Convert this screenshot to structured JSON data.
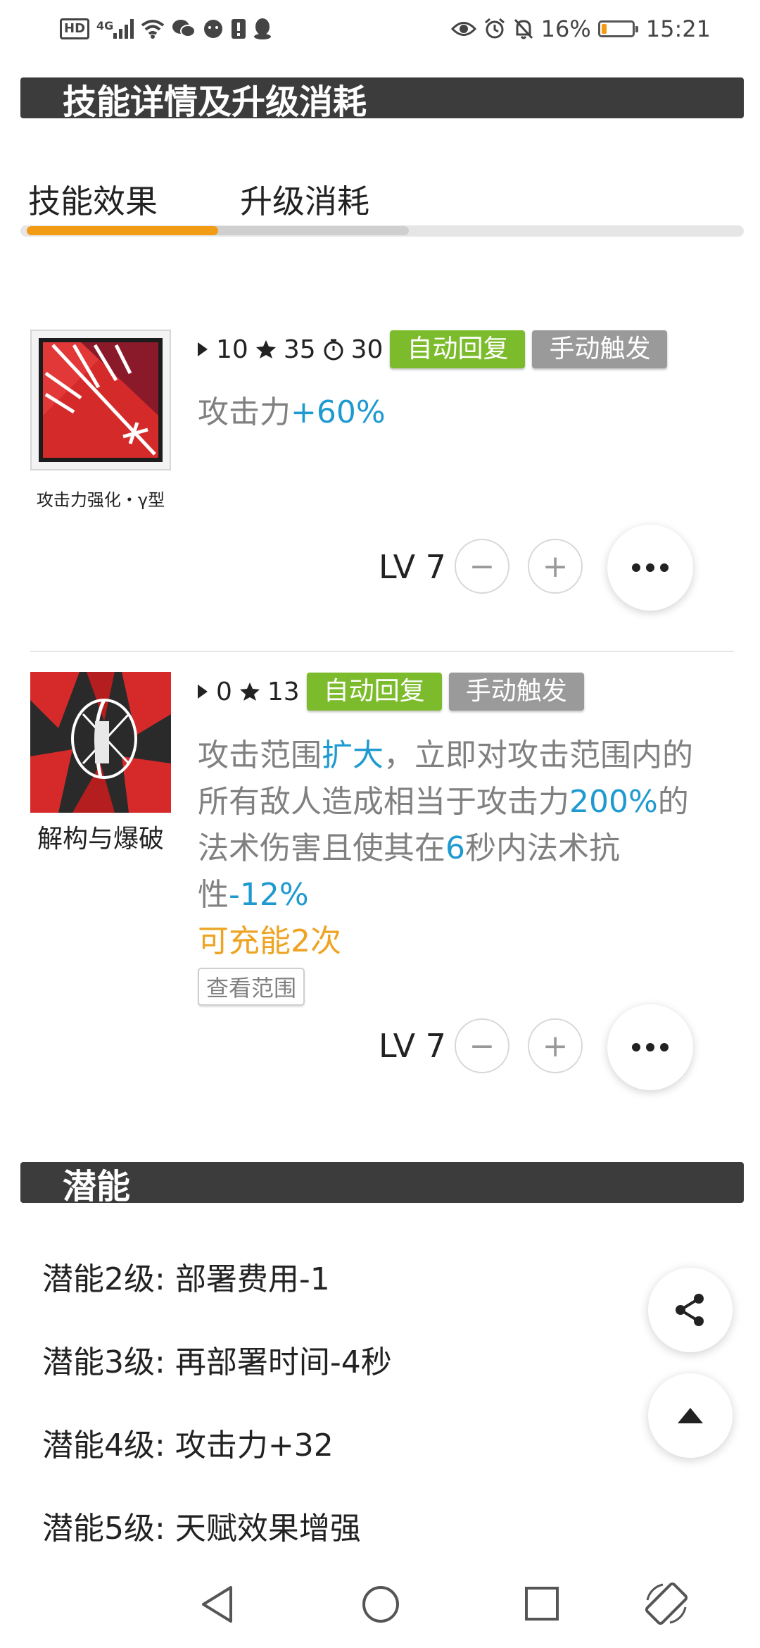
{
  "status_bar": {
    "network": "4G",
    "battery_percent": "16%",
    "battery_level": 0.16,
    "time": "15:21"
  },
  "section1": {
    "title": "技能详情及升级消耗"
  },
  "tabs": [
    {
      "label": "技能效果",
      "active": true
    },
    {
      "label": "升级消耗",
      "active": false
    }
  ],
  "skills": [
    {
      "name": "攻击力强化・γ型",
      "sp_initial": "10",
      "sp_cost": "35",
      "duration": "30",
      "badges": [
        "自动回复",
        "手动触发"
      ],
      "desc_parts": [
        "攻击力",
        "+60%"
      ],
      "level": "LV 7",
      "minus": "−",
      "plus": "+"
    },
    {
      "name": "解构与爆破",
      "sp_initial": "0",
      "sp_cost": "13",
      "badges": [
        "自动回复",
        "手动触发"
      ],
      "desc_line1": [
        "攻击范围",
        "扩大",
        "，立即对攻击范围内的"
      ],
      "desc_line2": [
        "所有敌人造成相当于攻击力",
        "200%",
        "的"
      ],
      "desc_line3": [
        "法术伤害且使其在",
        "6",
        "秒内法术抗"
      ],
      "desc_line4": [
        "性",
        "-12%"
      ],
      "charge_text": "可充能2次",
      "view_range": "查看范围",
      "level": "LV 7",
      "minus": "−",
      "plus": "+"
    }
  ],
  "section2": {
    "title": "潜能"
  },
  "potentials": [
    {
      "label": "潜能2级:",
      "value": "部署费用-1"
    },
    {
      "label": "潜能3级:",
      "value": "再部署时间-4秒"
    },
    {
      "label": "潜能4级:",
      "value": "攻击力+32"
    },
    {
      "label": "潜能5级:",
      "value": "天赋效果增强"
    }
  ],
  "colors": {
    "header_bg": "#3c3c3c",
    "accent_orange": "#f29b15",
    "badge_green": "#7cbc2c",
    "badge_gray": "#9a9a9a",
    "highlight_blue": "#1f9ad1",
    "charge_orange": "#eea322"
  },
  "icons": {
    "status_left": [
      "hd-icon",
      "signal-icon",
      "wifi-icon",
      "wechat-icon",
      "wechat-icon",
      "sim-alert-icon",
      "qq-icon"
    ],
    "status_right": [
      "eye-icon",
      "alarm-icon",
      "mute-icon",
      "battery-icon"
    ],
    "floating": [
      "share-icon",
      "scroll-top-icon"
    ],
    "nav": [
      "back-icon",
      "home-icon",
      "recents-icon",
      "rotate-icon"
    ]
  }
}
